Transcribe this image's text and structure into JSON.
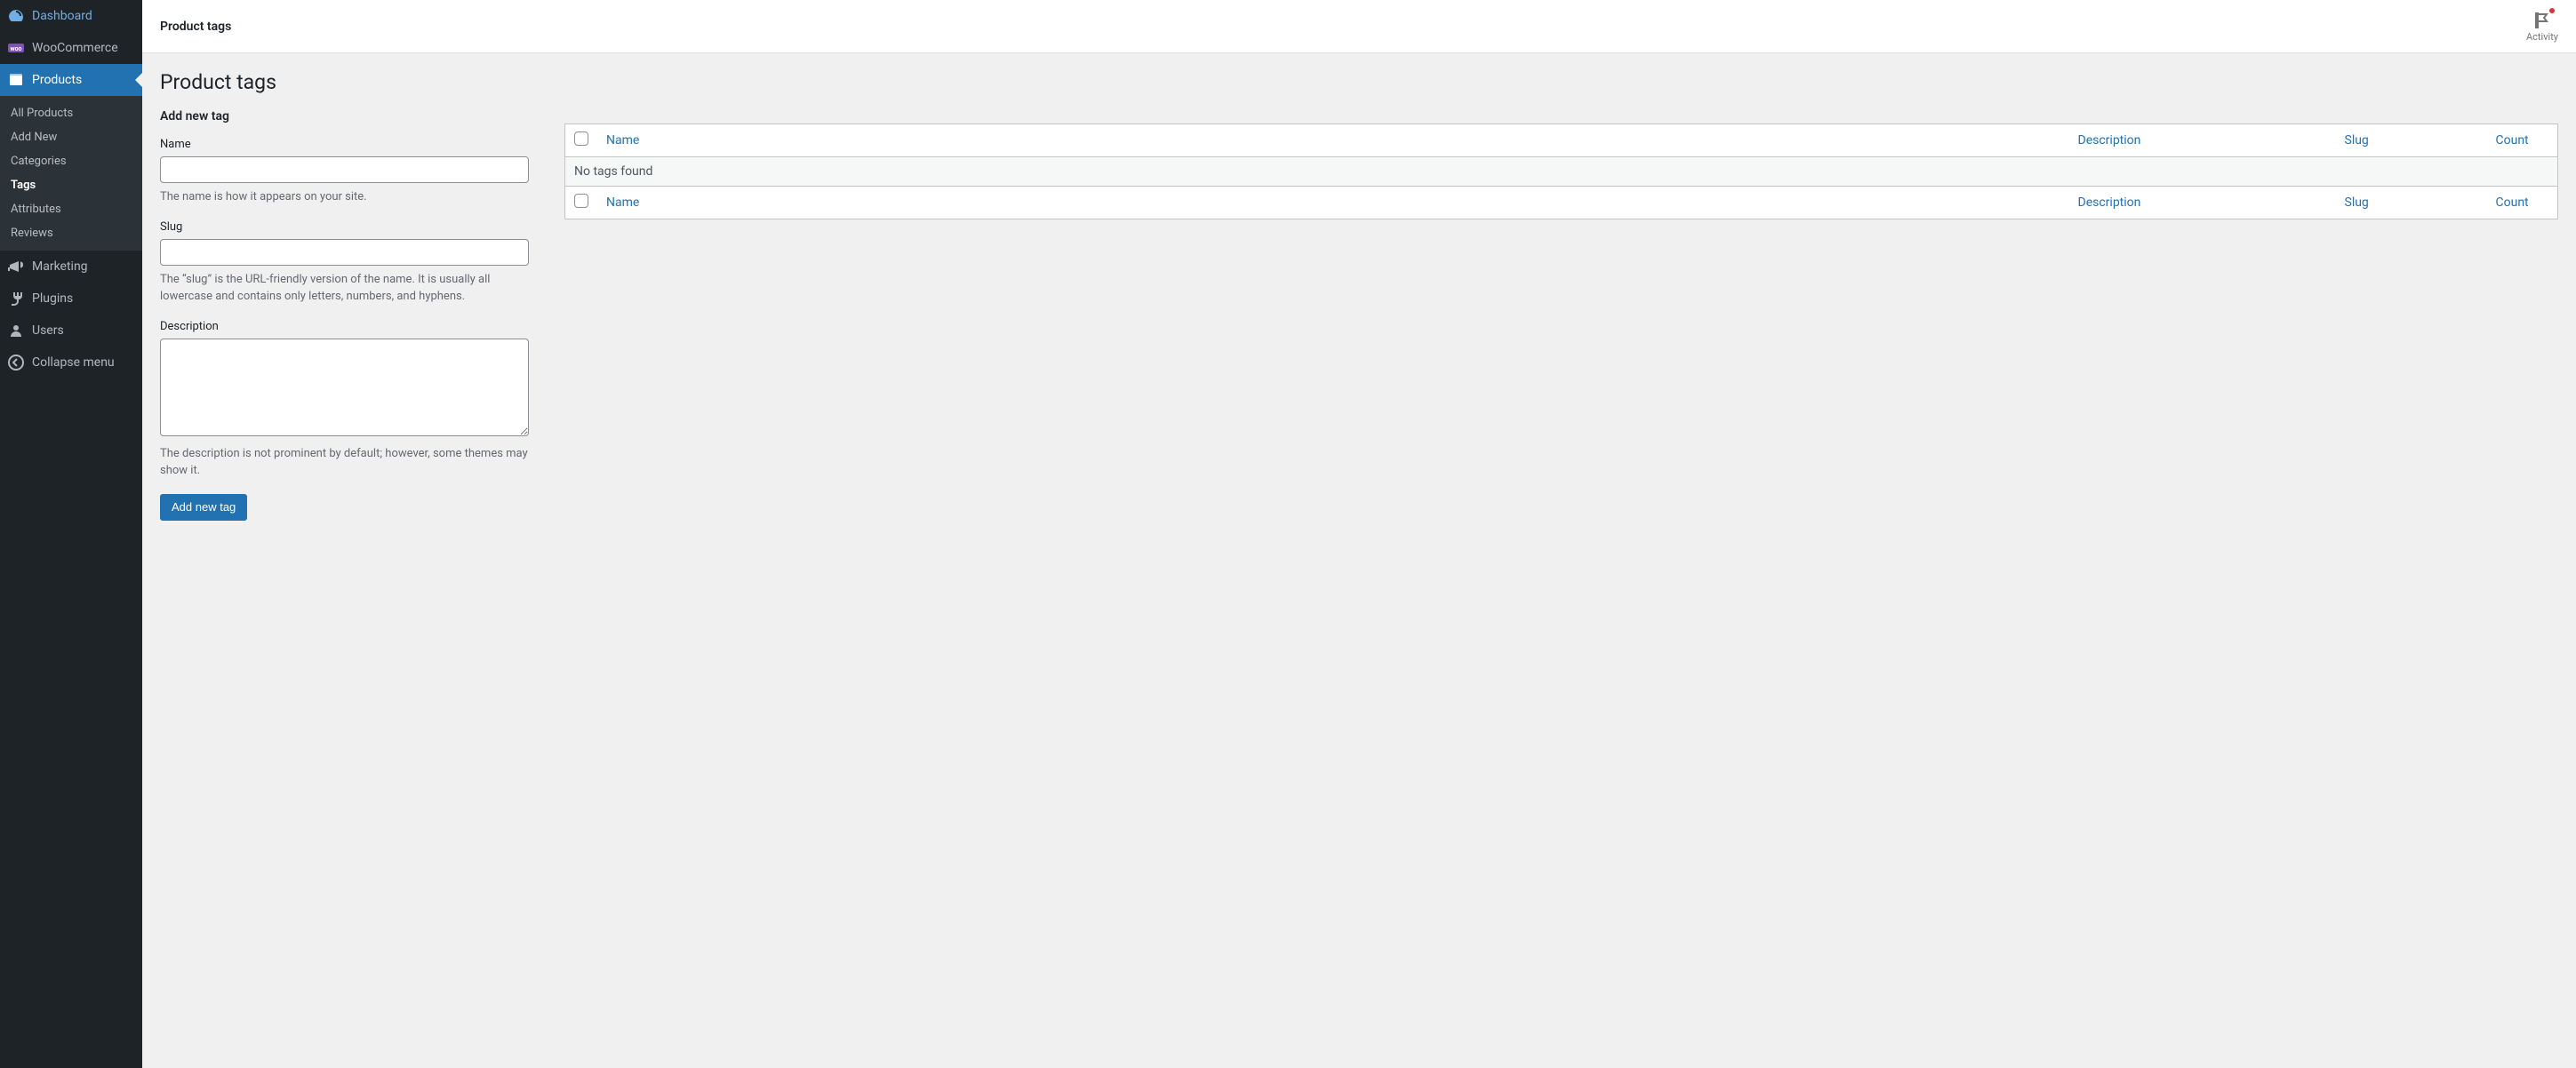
{
  "sidebar": {
    "items": [
      {
        "label": "Dashboard",
        "icon": "dashboard"
      },
      {
        "label": "WooCommerce",
        "icon": "woo"
      },
      {
        "label": "Products",
        "icon": "products",
        "current": true
      },
      {
        "label": "Marketing",
        "icon": "marketing"
      },
      {
        "label": "Plugins",
        "icon": "plugins"
      },
      {
        "label": "Users",
        "icon": "users"
      }
    ],
    "submenu": [
      {
        "label": "All Products"
      },
      {
        "label": "Add New"
      },
      {
        "label": "Categories"
      },
      {
        "label": "Tags",
        "current": true
      },
      {
        "label": "Attributes"
      },
      {
        "label": "Reviews"
      }
    ],
    "collapse_label": "Collapse menu"
  },
  "topbar": {
    "title": "Product tags",
    "activity_label": "Activity"
  },
  "page": {
    "heading": "Product tags",
    "form_heading": "Add new tag",
    "name_label": "Name",
    "name_help": "The name is how it appears on your site.",
    "slug_label": "Slug",
    "slug_help": "The “slug” is the URL-friendly version of the name. It is usually all lowercase and contains only letters, numbers, and hyphens.",
    "description_label": "Description",
    "description_help": "The description is not prominent by default; however, some themes may show it.",
    "submit_label": "Add new tag"
  },
  "table": {
    "columns": {
      "name": "Name",
      "description": "Description",
      "slug": "Slug",
      "count": "Count"
    },
    "empty": "No tags found"
  }
}
